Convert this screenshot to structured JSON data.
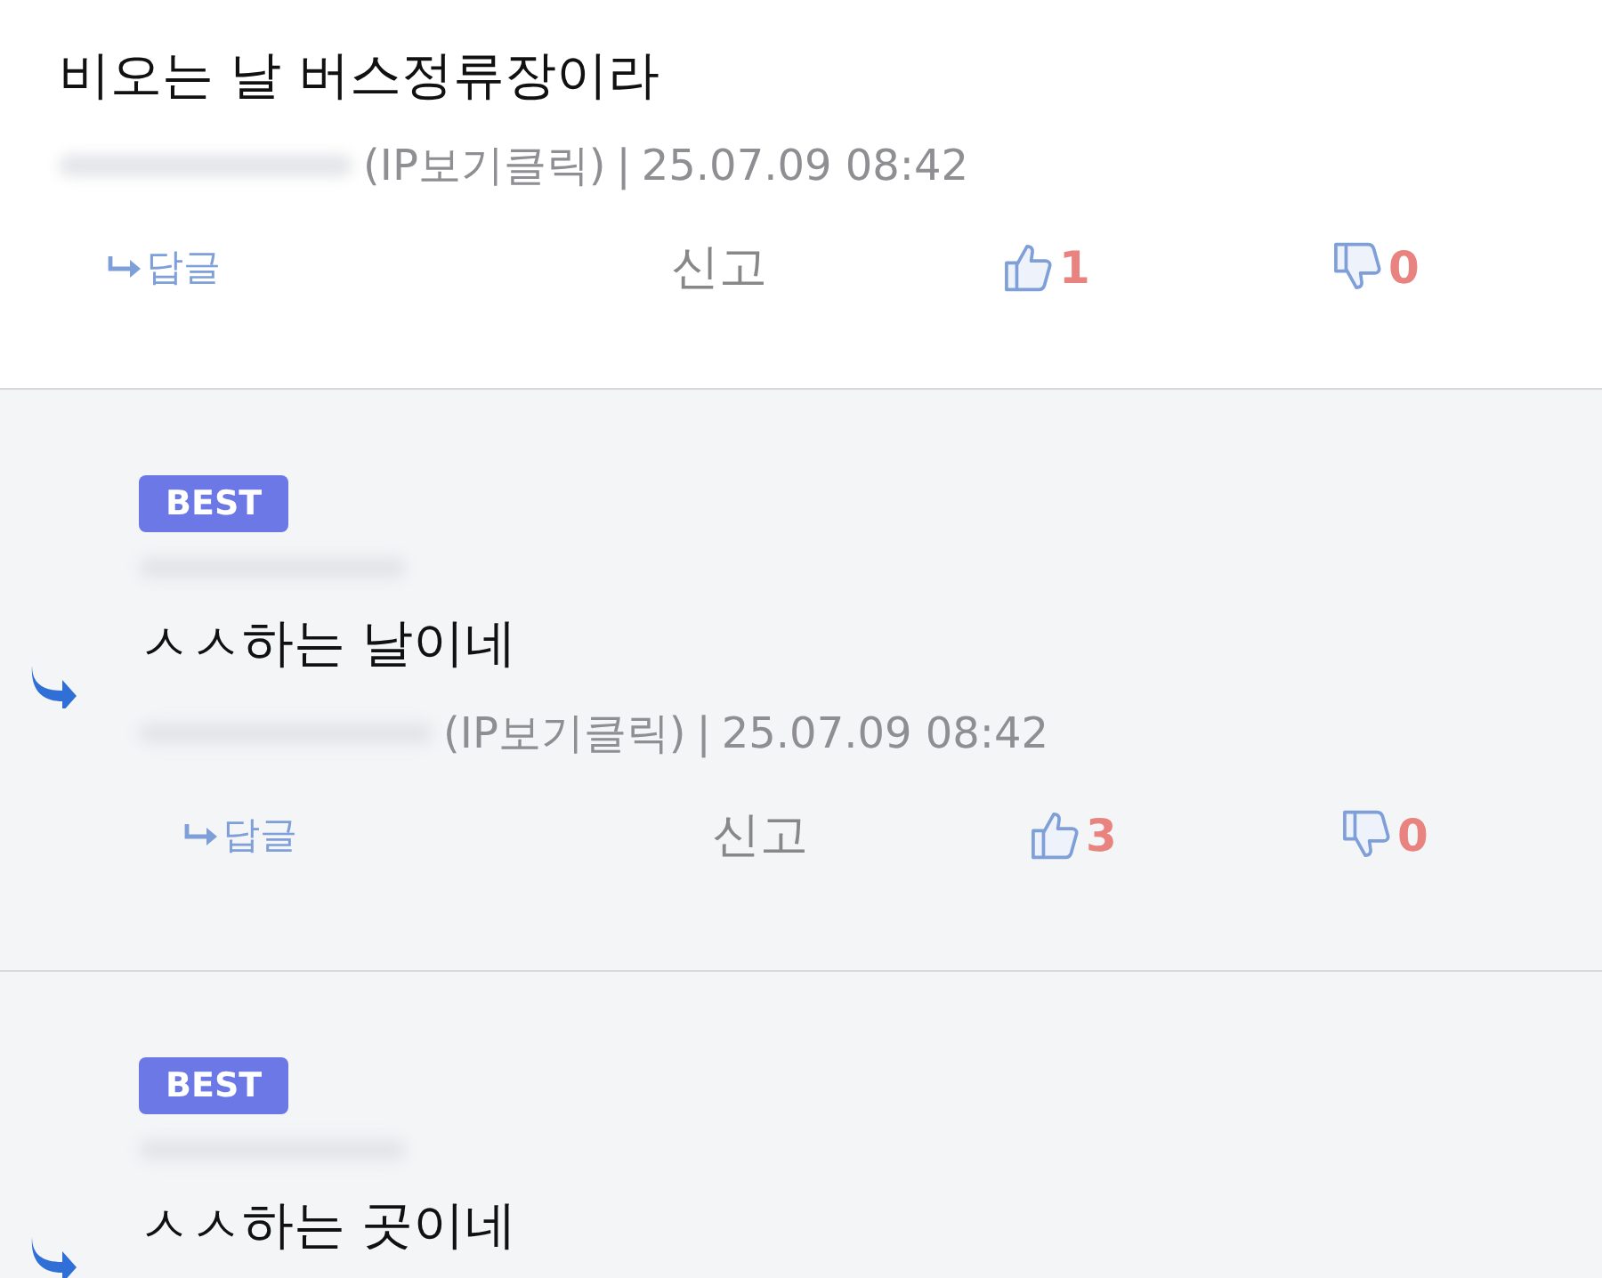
{
  "comments": [
    {
      "kind": "comment",
      "best": false,
      "text": "비오는 날 버스정류장이라",
      "ip": "(IP보기클릭)",
      "separator": "|",
      "date": "25.07.09 08:42",
      "reply": "답글",
      "report": "신고",
      "likes": "1",
      "dislikes": "0"
    },
    {
      "kind": "reply",
      "best": true,
      "badge": "BEST",
      "text": "ㅅㅅ하는 날이네",
      "ip": "(IP보기클릭)",
      "separator": "|",
      "date": "25.07.09 08:42",
      "reply": "답글",
      "report": "신고",
      "likes": "3",
      "dislikes": "0"
    },
    {
      "kind": "reply",
      "best": true,
      "badge": "BEST",
      "text": "ㅅㅅ하는 곳이네"
    }
  ]
}
